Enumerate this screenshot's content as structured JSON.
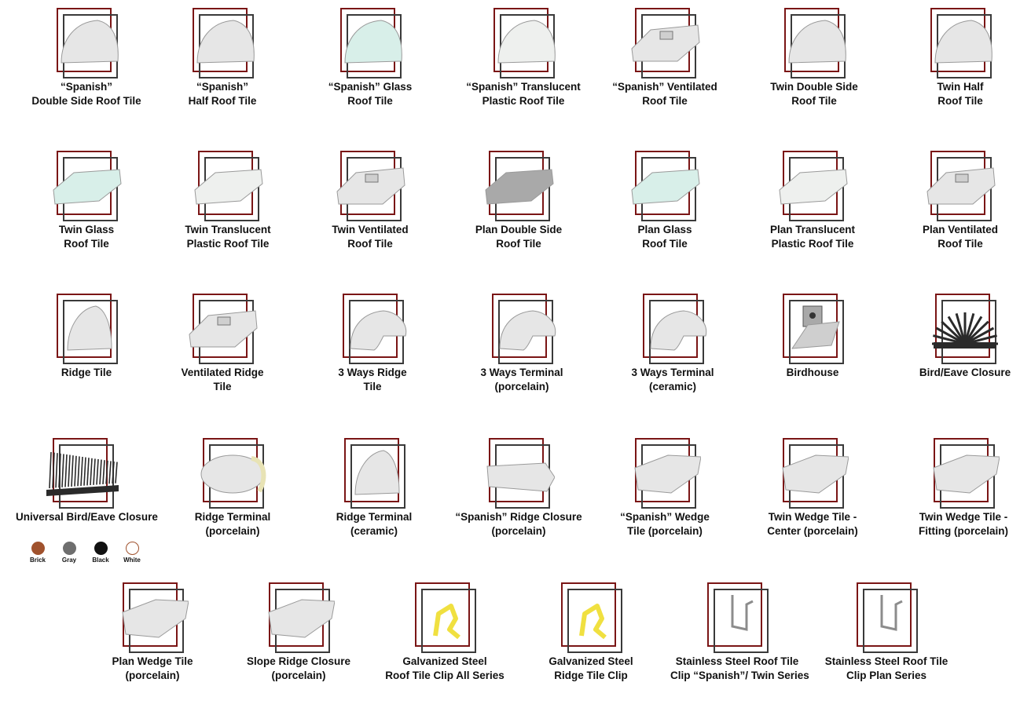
{
  "colors": {
    "frame_red": "#7a1515",
    "frame_dark": "#3a3a3a"
  },
  "products": [
    {
      "line1": "“Spanish”",
      "line2": "Double Side Roof Tile",
      "shape": "tile-shape-icon",
      "tone": "white"
    },
    {
      "line1": "“Spanish”",
      "line2": "Half Roof Tile",
      "shape": "tile-shape-icon",
      "tone": "white"
    },
    {
      "line1": "“Spanish” Glass",
      "line2": "Roof Tile",
      "shape": "tile-shape-icon",
      "tone": "glass"
    },
    {
      "line1": "“Spanish” Translucent",
      "line2": "Plastic Roof Tile",
      "shape": "tile-shape-icon",
      "tone": "translucent"
    },
    {
      "line1": "“Spanish” Ventilated",
      "line2": "Roof Tile",
      "shape": "ventilated-tile-icon",
      "tone": "white"
    },
    {
      "line1": "Twin Double Side",
      "line2": "Roof Tile",
      "shape": "tile-shape-icon",
      "tone": "white"
    },
    {
      "line1": "Twin Half",
      "line2": "Roof Tile",
      "shape": "tile-shape-icon",
      "tone": "white"
    },
    {
      "line1": "Twin Glass",
      "line2": "Roof Tile",
      "shape": "flat-tile-icon",
      "tone": "glass"
    },
    {
      "line1": "Twin Translucent",
      "line2": "Plastic Roof Tile",
      "shape": "flat-tile-icon",
      "tone": "translucent"
    },
    {
      "line1": "Twin Ventilated",
      "line2": "Roof Tile",
      "shape": "ventilated-tile-icon",
      "tone": "white"
    },
    {
      "line1": "Plan Double Side",
      "line2": "Roof Tile",
      "shape": "flat-tile-icon",
      "tone": "gray"
    },
    {
      "line1": "Plan Glass",
      "line2": "Roof Tile",
      "shape": "flat-tile-icon",
      "tone": "glass"
    },
    {
      "line1": "Plan Translucent",
      "line2": "Plastic Roof Tile",
      "shape": "flat-tile-icon",
      "tone": "translucent"
    },
    {
      "line1": "Plan Ventilated",
      "line2": "Roof Tile",
      "shape": "ventilated-tile-icon",
      "tone": "white"
    },
    {
      "line1": "Ridge Tile",
      "line2": "",
      "shape": "ridge-tile-icon",
      "tone": "white"
    },
    {
      "line1": "Ventilated Ridge",
      "line2": "Tile",
      "shape": "ventilated-tile-icon",
      "tone": "white"
    },
    {
      "line1": "3 Ways Ridge",
      "line2": "Tile",
      "shape": "three-way-icon",
      "tone": "white"
    },
    {
      "line1": "3 Ways Terminal",
      "line2": "(porcelain)",
      "shape": "three-way-icon",
      "tone": "white"
    },
    {
      "line1": "3 Ways Terminal",
      "line2": "(ceramic)",
      "shape": "three-way-icon",
      "tone": "white"
    },
    {
      "line1": "Birdhouse",
      "line2": "",
      "shape": "birdhouse-icon",
      "tone": "gray"
    },
    {
      "line1": "Bird/Eave Closure",
      "line2": "",
      "shape": "eave-closure-icon",
      "tone": "dark"
    },
    {
      "line1": "Universal Bird/Eave Closure",
      "line2": "",
      "shape": "comb-closure-icon",
      "tone": "dark"
    },
    {
      "line1": "Ridge Terminal",
      "line2": "(porcelain)",
      "shape": "dome-terminal-icon",
      "tone": "white"
    },
    {
      "line1": "Ridge Terminal",
      "line2": "(ceramic)",
      "shape": "ridge-tile-icon",
      "tone": "white"
    },
    {
      "line1": "“Spanish” Ridge Closure",
      "line2": "(porcelain)",
      "shape": "block-closure-icon",
      "tone": "white"
    },
    {
      "line1": "“Spanish” Wedge",
      "line2": "Tile (porcelain)",
      "shape": "wedge-icon",
      "tone": "white"
    },
    {
      "line1": "Twin Wedge Tile -",
      "line2": "Center (porcelain)",
      "shape": "wedge-icon",
      "tone": "white"
    },
    {
      "line1": "Twin Wedge Tile -",
      "line2": "Fitting (porcelain)",
      "shape": "wedge-icon",
      "tone": "white"
    },
    {
      "line1": "Plan Wedge Tile",
      "line2": "(porcelain)",
      "shape": "wedge-icon",
      "tone": "white"
    },
    {
      "line1": "Slope Ridge Closure",
      "line2": "(porcelain)",
      "shape": "wedge-icon",
      "tone": "white"
    },
    {
      "line1": "Galvanized Steel",
      "line2": "Roof Tile Clip All Series",
      "shape": "clip-icon",
      "tone": "yellow"
    },
    {
      "line1": "Galvanized Steel",
      "line2": "Ridge Tile Clip",
      "shape": "clip-icon",
      "tone": "yellow"
    },
    {
      "line1": "Stainless Steel Roof Tile",
      "line2": "Clip “Spanish”/ Twin Series",
      "shape": "hook-clip-icon",
      "tone": "steel"
    },
    {
      "line1": "Stainless Steel Roof Tile",
      "line2": "Clip Plan Series",
      "shape": "hook-clip-icon",
      "tone": "steel"
    }
  ],
  "swatches": [
    {
      "label": "Brick",
      "color": "#a0522d"
    },
    {
      "label": "Gray",
      "color": "#6e6e6e"
    },
    {
      "label": "Black",
      "color": "#111111"
    },
    {
      "label": "White",
      "color": "#ffffff"
    }
  ]
}
